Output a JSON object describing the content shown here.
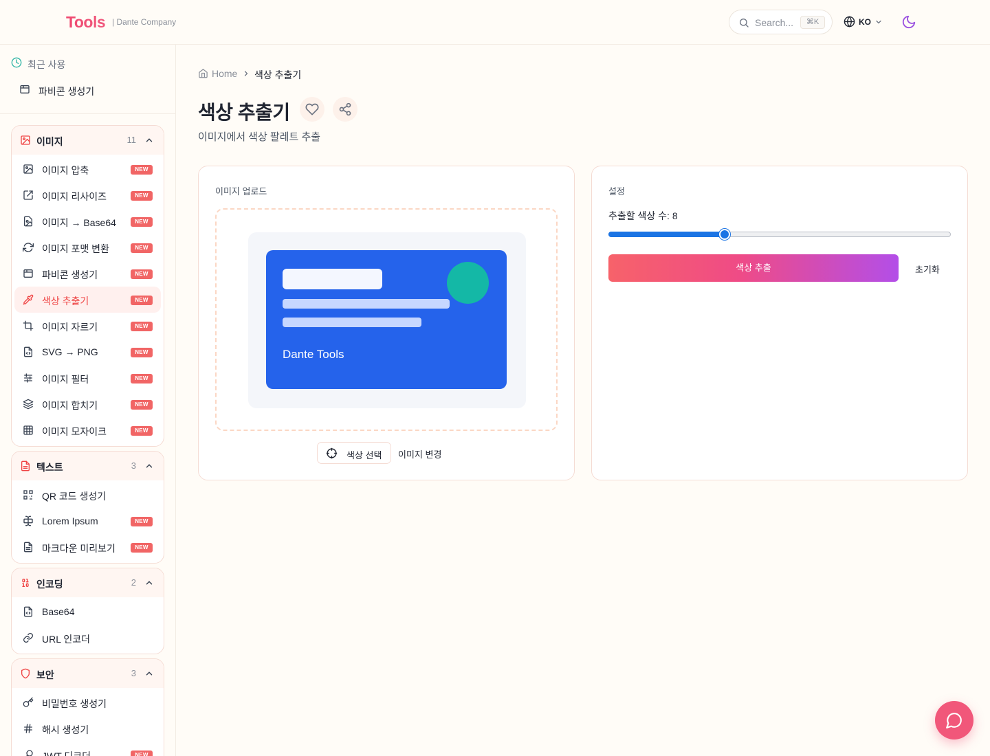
{
  "brand": {
    "logo": "Tools",
    "company": "| Dante Company"
  },
  "header": {
    "search_placeholder": "Search...",
    "search_shortcut": "⌘K",
    "language": "KO",
    "theme_icon": "moon-icon"
  },
  "sidebar": {
    "recent_label": "최근 사용",
    "recent_items": [
      {
        "label": "파비콘 생성기",
        "icon": "browser-icon"
      }
    ],
    "groups": [
      {
        "name": "이미지",
        "count": "11",
        "icon": "image-icon",
        "items": [
          {
            "label": "이미지 압축",
            "badge": "NEW",
            "icon": "image-compress-icon"
          },
          {
            "label": "이미지 리사이즈",
            "badge": "NEW",
            "icon": "resize-icon"
          },
          {
            "label": "이미지 → Base64",
            "badge": "NEW",
            "icon": "file-image-icon"
          },
          {
            "label": "이미지 포맷 변환",
            "badge": "NEW",
            "icon": "refresh-icon"
          },
          {
            "label": "파비콘 생성기",
            "badge": "NEW",
            "icon": "browser-icon"
          },
          {
            "label": "색상 추출기",
            "badge": "NEW",
            "icon": "pipette-icon",
            "active": true
          },
          {
            "label": "이미지 자르기",
            "badge": "NEW",
            "icon": "crop-icon"
          },
          {
            "label": "SVG → PNG",
            "badge": "NEW",
            "icon": "file-code-icon"
          },
          {
            "label": "이미지 필터",
            "badge": "NEW",
            "icon": "sliders-icon"
          },
          {
            "label": "이미지 합치기",
            "badge": "NEW",
            "icon": "layers-icon"
          },
          {
            "label": "이미지 모자이크",
            "badge": "NEW",
            "icon": "grid-icon"
          }
        ]
      },
      {
        "name": "텍스트",
        "count": "3",
        "icon": "file-text-icon",
        "items": [
          {
            "label": "QR 코드 생성기",
            "badge": "",
            "icon": "qr-code-icon"
          },
          {
            "label": "Lorem Ipsum",
            "badge": "NEW",
            "icon": "text-cursor-icon"
          },
          {
            "label": "마크다운 미리보기",
            "badge": "NEW",
            "icon": "file-text-icon"
          }
        ]
      },
      {
        "name": "인코딩",
        "count": "2",
        "icon": "binary-icon",
        "items": [
          {
            "label": "Base64",
            "badge": "",
            "icon": "file-code-icon"
          },
          {
            "label": "URL 인코더",
            "badge": "",
            "icon": "link-icon"
          }
        ]
      },
      {
        "name": "보안",
        "count": "3",
        "icon": "shield-icon",
        "items": [
          {
            "label": "비밀번호 생성기",
            "badge": "",
            "icon": "key-icon"
          },
          {
            "label": "해시 생성기",
            "badge": "",
            "icon": "hash-icon"
          },
          {
            "label": "JWT 디코더",
            "badge": "NEW",
            "icon": "key-round-icon"
          }
        ]
      }
    ]
  },
  "breadcrumb": {
    "home": "Home",
    "current": "색상 추출기"
  },
  "page": {
    "title": "색상 추출기",
    "subtitle": "이미지에서 색상 팔레트 추출"
  },
  "upload": {
    "title": "이미지 업로드",
    "preview_text": "Dante Tools",
    "pick_color_label": "색상 선택",
    "change_image_label": "이미지 변경"
  },
  "settings": {
    "title": "설정",
    "count_label": "추출할 색상 수: 8",
    "slider": {
      "min": 2,
      "max": 20,
      "value": 8
    },
    "extract_label": "색상 추출",
    "reset_label": "초기화"
  },
  "colors": {
    "brand": "#ef476f",
    "accent_blue": "#1b74e4",
    "preview_blue": "#2563eb",
    "preview_teal": "#14b8a6",
    "badge_red": "#f16565"
  }
}
